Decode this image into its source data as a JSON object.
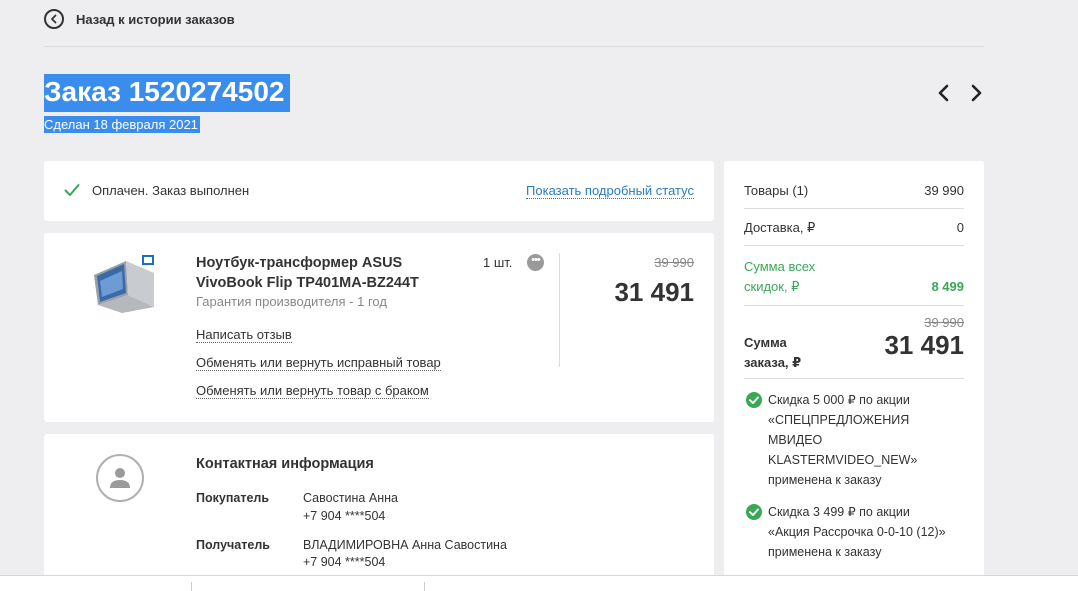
{
  "back": {
    "label": "Назад к истории заказов"
  },
  "order": {
    "title": "Заказ 1520274502",
    "date": "Сделан 18 февраля 2021"
  },
  "status": {
    "text": "Оплачен. Заказ выполнен",
    "link": "Показать подробный статус"
  },
  "item": {
    "name": "Ноутбук-трансформер ASUS VivoBook Flip TP401MA-BZ244T",
    "warranty": "Гарантия производителя - 1 год",
    "qty": "1 шт.",
    "more": "•••",
    "old_price": "39 990",
    "price": "31 491",
    "links": {
      "review": "Написать отзыв",
      "exchange_good": "Обменять или вернуть исправный товар",
      "exchange_defect": "Обменять или вернуть товар с браком"
    }
  },
  "contact": {
    "title": "Контактная информация",
    "buyer_label": "Покупатель",
    "buyer_name": "Савостина Анна",
    "buyer_phone": "+7 904 ****504",
    "recipient_label": "Получатель",
    "recipient_name": "ВЛАДИМИРОВНА Анна Савостина",
    "recipient_phone": "+7 904 ****504"
  },
  "summary": {
    "goods_label": "Товары (1)",
    "goods_value": "39 990",
    "delivery_label": "Доставка, ₽",
    "delivery_value": "0",
    "discount_label_1": "Сумма всех",
    "discount_label_2": "скидок, ₽",
    "discount_value": "8 499",
    "old_total": "39 990",
    "total_label_1": "Сумма",
    "total_label_2": "заказа, ₽",
    "total_value": "31 491",
    "promo1": [
      "Скидка 5 000 ₽ по акции",
      "«СПЕЦПРЕДЛОЖЕНИЯ",
      "МВИДЕО",
      "KLASTERMVIDEO_NEW»",
      "применена к заказу"
    ],
    "promo2": [
      "Скидка 3 499 ₽ по акции",
      "«Акция Рассрочка 0-0-10 (12)»",
      "применена к заказу"
    ]
  },
  "colors": {
    "accent": "#2b7bbf",
    "selection": "#3b8ded",
    "success": "#3aa757",
    "background": "#eeeef0"
  },
  "icons": [
    "back-arrow-icon",
    "chevron-left-icon",
    "chevron-right-icon",
    "checkmark-icon",
    "user-icon",
    "laptop-image"
  ]
}
